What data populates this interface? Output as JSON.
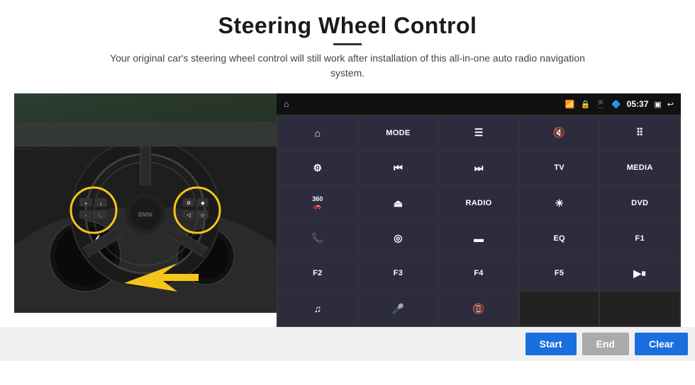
{
  "page": {
    "title": "Steering Wheel Control",
    "subtitle": "Your original car's steering wheel control will still work after installation of this all-in-one auto radio navigation system."
  },
  "statusbar": {
    "time": "05:37"
  },
  "panel_buttons": [
    {
      "id": "btn-home",
      "icon": "⌂",
      "label": "",
      "type": "icon"
    },
    {
      "id": "btn-mode",
      "icon": "",
      "label": "MODE",
      "type": "text"
    },
    {
      "id": "btn-list",
      "icon": "☰",
      "label": "",
      "type": "icon"
    },
    {
      "id": "btn-mute",
      "icon": "🔇",
      "label": "",
      "type": "icon"
    },
    {
      "id": "btn-apps",
      "icon": "⋯",
      "label": "",
      "type": "icon"
    },
    {
      "id": "btn-settings",
      "icon": "⚙",
      "label": "",
      "type": "icon"
    },
    {
      "id": "btn-prev",
      "icon": "⏮",
      "label": "",
      "type": "icon"
    },
    {
      "id": "btn-next",
      "icon": "⏭",
      "label": "",
      "type": "icon"
    },
    {
      "id": "btn-tv",
      "icon": "",
      "label": "TV",
      "type": "text"
    },
    {
      "id": "btn-media",
      "icon": "",
      "label": "MEDIA",
      "type": "text"
    },
    {
      "id": "btn-360",
      "icon": "360",
      "label": "",
      "type": "icon"
    },
    {
      "id": "btn-eject",
      "icon": "⏏",
      "label": "",
      "type": "icon"
    },
    {
      "id": "btn-radio",
      "icon": "",
      "label": "RADIO",
      "type": "text"
    },
    {
      "id": "btn-brightness",
      "icon": "☀",
      "label": "",
      "type": "icon"
    },
    {
      "id": "btn-dvd",
      "icon": "",
      "label": "DVD",
      "type": "text"
    },
    {
      "id": "btn-phone",
      "icon": "📞",
      "label": "",
      "type": "icon"
    },
    {
      "id": "btn-nav",
      "icon": "◎",
      "label": "",
      "type": "icon"
    },
    {
      "id": "btn-screen",
      "icon": "▬",
      "label": "",
      "type": "icon"
    },
    {
      "id": "btn-eq",
      "icon": "",
      "label": "EQ",
      "type": "text"
    },
    {
      "id": "btn-f1",
      "icon": "",
      "label": "F1",
      "type": "text"
    },
    {
      "id": "btn-f2",
      "icon": "",
      "label": "F2",
      "type": "text"
    },
    {
      "id": "btn-f3",
      "icon": "",
      "label": "F3",
      "type": "text"
    },
    {
      "id": "btn-f4",
      "icon": "",
      "label": "F4",
      "type": "text"
    },
    {
      "id": "btn-f5",
      "icon": "",
      "label": "F5",
      "type": "text"
    },
    {
      "id": "btn-playpause",
      "icon": "▶⏸",
      "label": "",
      "type": "icon"
    },
    {
      "id": "btn-music",
      "icon": "♫",
      "label": "",
      "type": "icon"
    },
    {
      "id": "btn-mic",
      "icon": "🎤",
      "label": "",
      "type": "icon"
    },
    {
      "id": "btn-hangup",
      "icon": "📵",
      "label": "",
      "type": "icon"
    },
    {
      "id": "btn-empty1",
      "icon": "",
      "label": "",
      "type": "empty"
    },
    {
      "id": "btn-empty2",
      "icon": "",
      "label": "",
      "type": "empty"
    }
  ],
  "bottom_buttons": {
    "start": "Start",
    "end": "End",
    "clear": "Clear"
  }
}
